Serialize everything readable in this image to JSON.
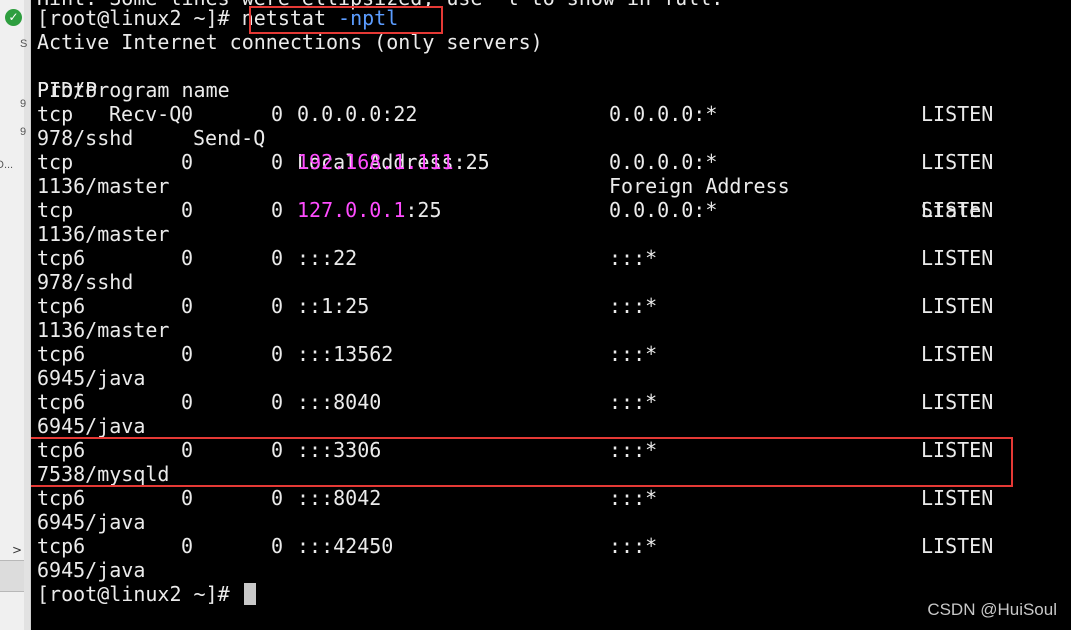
{
  "sidebar": {
    "status_icon": "check-circle-icon",
    "fragments": [
      "S",
      "9",
      "9",
      "D..."
    ],
    "expand_arrow": ">"
  },
  "terminal": {
    "partial_line": "Hint: Some lines were ellipsized, use -l to show in full.",
    "prompt": "[root@linux2 ~]# ",
    "command": "netstat",
    "args": "-nptl",
    "heading": "Active Internet connections (only servers)",
    "header": {
      "proto": "Proto",
      "recvq": "Recv-Q",
      "sendq": "Send-Q",
      "local": "Local Address",
      "foreign": "Foreign Address",
      "state": "State",
      "program": "PID/Program name"
    },
    "rows": [
      {
        "proto": "tcp",
        "recvq": "0",
        "sendq": "0",
        "local_ip": "",
        "local_rest": "0.0.0.0:22",
        "foreign": "0.0.0.0:*",
        "state": "LISTEN",
        "program": "978/sshd"
      },
      {
        "proto": "tcp",
        "recvq": "0",
        "sendq": "0",
        "local_ip": "192.168.1.111",
        "local_rest": ":25",
        "foreign": "0.0.0.0:*",
        "state": "LISTEN",
        "program": "1136/master"
      },
      {
        "proto": "tcp",
        "recvq": "0",
        "sendq": "0",
        "local_ip": "127.0.0.1",
        "local_rest": ":25",
        "foreign": "0.0.0.0:*",
        "state": "LISTEN",
        "program": "1136/master"
      },
      {
        "proto": "tcp6",
        "recvq": "0",
        "sendq": "0",
        "local_ip": "",
        "local_rest": ":::22",
        "foreign": ":::*",
        "state": "LISTEN",
        "program": "978/sshd"
      },
      {
        "proto": "tcp6",
        "recvq": "0",
        "sendq": "0",
        "local_ip": "",
        "local_rest": "::1:25",
        "foreign": ":::*",
        "state": "LISTEN",
        "program": "1136/master"
      },
      {
        "proto": "tcp6",
        "recvq": "0",
        "sendq": "0",
        "local_ip": "",
        "local_rest": ":::13562",
        "foreign": ":::*",
        "state": "LISTEN",
        "program": "6945/java"
      },
      {
        "proto": "tcp6",
        "recvq": "0",
        "sendq": "0",
        "local_ip": "",
        "local_rest": ":::8040",
        "foreign": ":::*",
        "state": "LISTEN",
        "program": "6945/java"
      },
      {
        "proto": "tcp6",
        "recvq": "0",
        "sendq": "0",
        "local_ip": "",
        "local_rest": ":::3306",
        "foreign": ":::*",
        "state": "LISTEN",
        "program": "7538/mysqld"
      },
      {
        "proto": "tcp6",
        "recvq": "0",
        "sendq": "0",
        "local_ip": "",
        "local_rest": ":::8042",
        "foreign": ":::*",
        "state": "LISTEN",
        "program": "6945/java"
      },
      {
        "proto": "tcp6",
        "recvq": "0",
        "sendq": "0",
        "local_ip": "",
        "local_rest": ":::42450",
        "foreign": ":::*",
        "state": "LISTEN",
        "program": "6945/java"
      }
    ],
    "final_prompt": "[root@linux2 ~]# "
  },
  "watermark": "CSDN @HuiSoul",
  "colors": {
    "background": "#000000",
    "text": "#ebebeb",
    "ip_highlight": "#ff4cff",
    "option_highlight": "#5b9cff",
    "annotation_box": "#e53935"
  }
}
